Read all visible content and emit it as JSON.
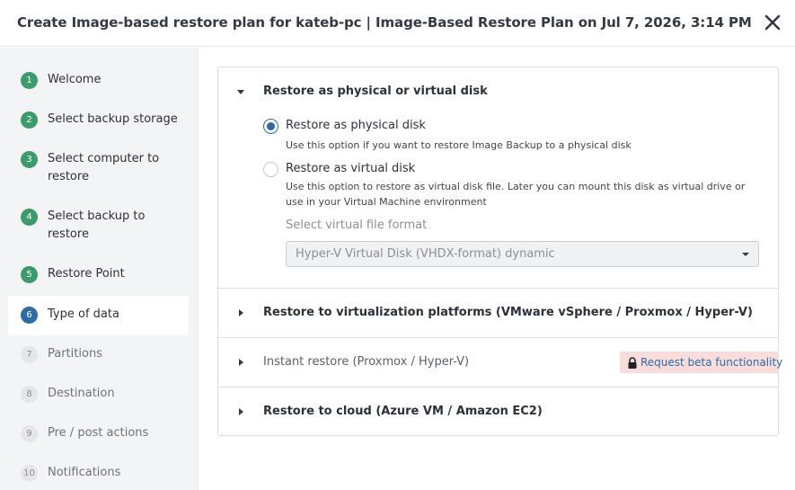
{
  "header": {
    "title": "Create Image-based restore plan for kateb-pc | Image-Based Restore Plan on Jul 7, 2026, 3:14 PM"
  },
  "sidebar": {
    "steps": [
      {
        "num": "1",
        "label": "Welcome",
        "state": "done"
      },
      {
        "num": "2",
        "label": "Select backup storage",
        "state": "done"
      },
      {
        "num": "3",
        "label": "Select computer to restore",
        "state": "done"
      },
      {
        "num": "4",
        "label": "Select backup to restore",
        "state": "done"
      },
      {
        "num": "5",
        "label": "Restore Point",
        "state": "done"
      },
      {
        "num": "6",
        "label": "Type of data",
        "state": "active"
      },
      {
        "num": "7",
        "label": "Partitions",
        "state": "todo"
      },
      {
        "num": "8",
        "label": "Destination",
        "state": "todo"
      },
      {
        "num": "9",
        "label": "Pre / post actions",
        "state": "todo"
      },
      {
        "num": "10",
        "label": "Notifications",
        "state": "todo"
      }
    ]
  },
  "main": {
    "sections": [
      {
        "title": "Restore as physical or virtual disk",
        "expanded": true,
        "options": [
          {
            "label": "Restore as physical disk",
            "selected": true,
            "description": "Use this option if you want to restore Image Backup to a physical disk"
          },
          {
            "label": "Restore as virtual disk",
            "selected": false,
            "description": "Use this option to restore as virtual disk file. Later you can mount this disk as virtual drive or use in your Virtual Machine environment"
          }
        ],
        "format_label": "Select virtual file format",
        "format_value": "Hyper-V Virtual Disk (VHDX-format) dynamic"
      },
      {
        "title": "Restore to virtualization platforms (VMware vSphere / Proxmox / Hyper-V)",
        "expanded": false
      },
      {
        "title": "Instant restore (Proxmox / Hyper-V)",
        "expanded": false,
        "badge": "Request beta functionality"
      },
      {
        "title": "Restore to cloud (Azure VM / Amazon EC2)",
        "expanded": false
      }
    ]
  },
  "colors": {
    "accent": "#2e6ba3",
    "done_step": "#3d9a6a",
    "beta_badge_bg": "#f9dcdc"
  },
  "icons": {
    "close": "close-icon",
    "lock": "lock-icon",
    "chevron": "chevron-icon"
  }
}
